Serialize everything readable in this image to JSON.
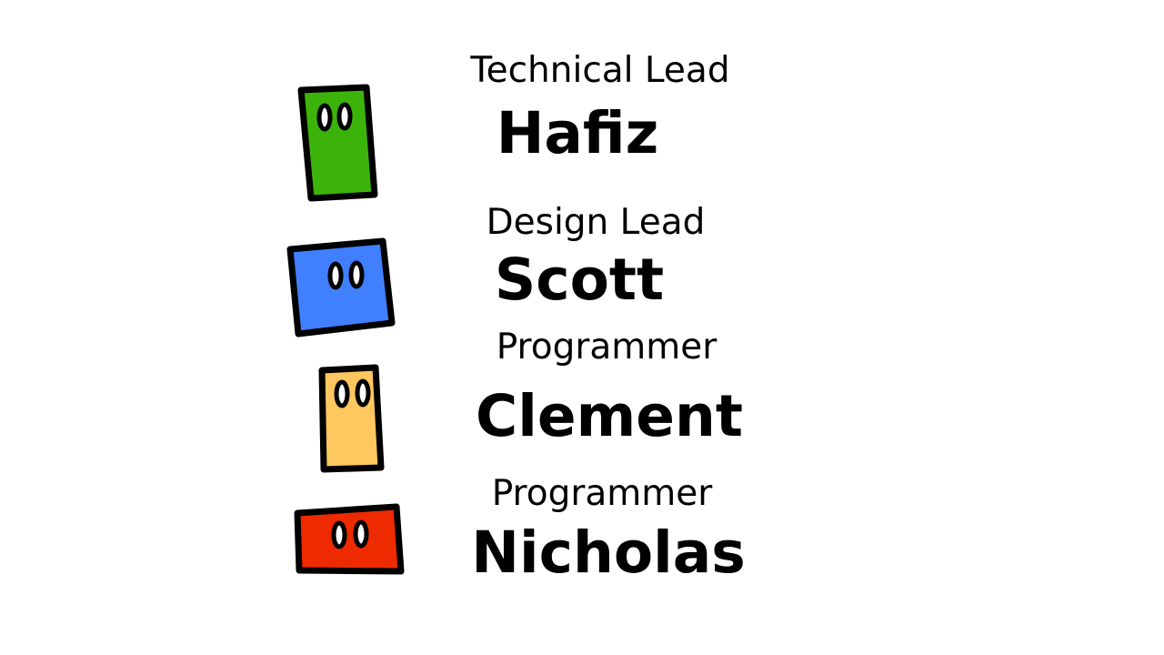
{
  "credits": [
    {
      "role": "Technical Lead",
      "name": "Hafiz",
      "color": "#3cb30a",
      "icon": "green-block-creature"
    },
    {
      "role": "Design Lead",
      "name": "Scott",
      "color": "#4080ff",
      "icon": "blue-block-creature"
    },
    {
      "role": "Programmer",
      "name": "Clement",
      "color": "#ffc75f",
      "icon": "yellow-block-creature"
    },
    {
      "role": "Programmer",
      "name": "Nicholas",
      "color": "#ee2a00",
      "icon": "red-block-creature"
    }
  ]
}
